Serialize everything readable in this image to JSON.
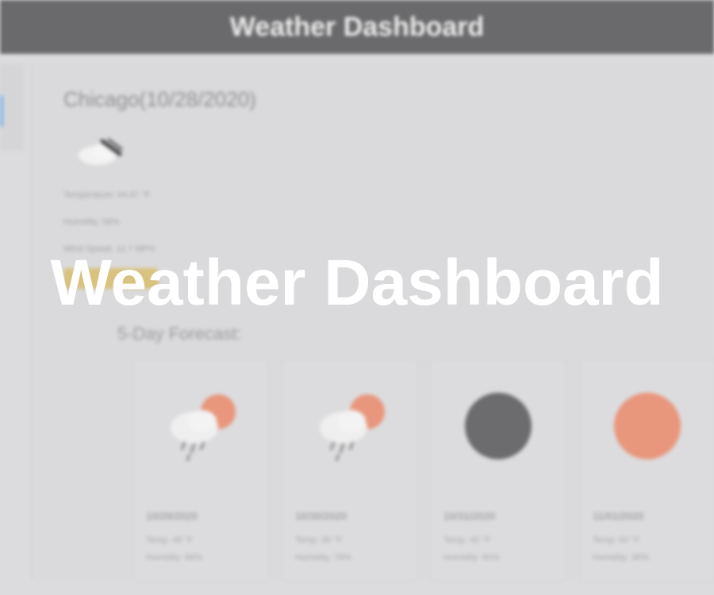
{
  "header": {
    "title": "Weather Dashboard"
  },
  "overlay": {
    "title": "Weather Dashboard"
  },
  "current": {
    "city_heading": "Chicago(10/28/2020)",
    "icon": "rain-cloud-icon",
    "temperature": "Temperature: 44.87 °F",
    "humidity": "Humidity: 58%",
    "wind_speed": "Wind Speed: 12.7 MPH",
    "uv_index": "UV Index: 3.2"
  },
  "forecast": {
    "heading": "5-Day Forecast:",
    "days": [
      {
        "date": "10/29/2020",
        "icon": "sun-rain-icon",
        "temp": "Temp: 48 °F",
        "humidity": "Humidity: 66%"
      },
      {
        "date": "10/30/2020",
        "icon": "sun-rain-icon",
        "temp": "Temp: 39 °F",
        "humidity": "Humidity: 79%"
      },
      {
        "date": "10/31/2020",
        "icon": "moon-icon",
        "temp": "Temp: 42 °F",
        "humidity": "Humidity: 60%"
      },
      {
        "date": "11/01/2020",
        "icon": "sun-icon",
        "temp": "Temp: 50 °F",
        "humidity": "Humidity: 38%"
      }
    ]
  },
  "colors": {
    "header_bg": "#6a696b",
    "uv_badge": "#d9c27d",
    "sun": "#e8967c",
    "moon": "#6c6b6d",
    "accent": "#7fb2e8"
  }
}
